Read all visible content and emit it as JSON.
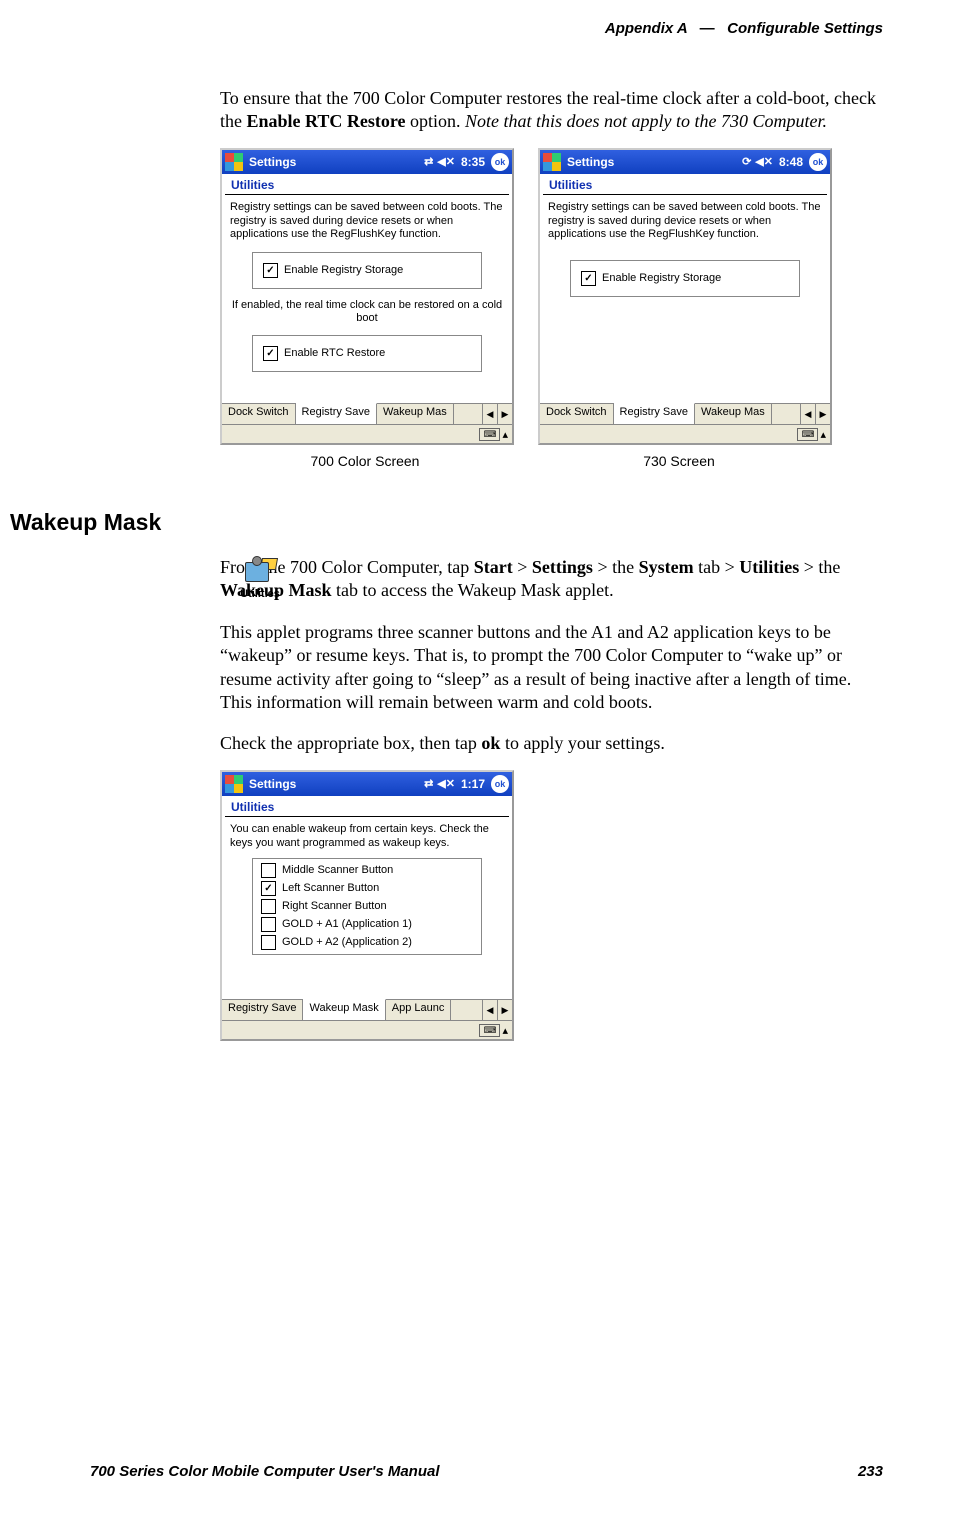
{
  "header": {
    "appendix": "Appendix A",
    "dash": "—",
    "title": "Configurable Settings"
  },
  "intro_para": {
    "pre": "To ensure that the 700 Color Computer restores the real-time clock after a cold-boot, check the ",
    "bold": "Enable RTC Restore",
    "mid": " option. ",
    "italic": "Note that this does not apply to the 730 Computer."
  },
  "screenshot_a": {
    "titlebar": {
      "title": "Settings",
      "time": "8:35",
      "ok": "ok"
    },
    "applet_title": "Utilities",
    "desc": "Registry settings can be saved between cold boots. The registry is saved during device resets or when applications use the RegFlushKey function.",
    "check1": {
      "label": "Enable Registry Storage",
      "checked": true
    },
    "note": "If enabled, the real time clock can be restored on a cold boot",
    "check2": {
      "label": "Enable RTC Restore",
      "checked": true
    },
    "tabs": [
      "Dock Switch",
      "Registry Save",
      "Wakeup Mas"
    ],
    "active_tab": 1,
    "caption": "700 Color Screen"
  },
  "screenshot_b": {
    "titlebar": {
      "title": "Settings",
      "time": "8:48",
      "ok": "ok"
    },
    "applet_title": "Utilities",
    "desc": "Registry settings can be saved between cold boots. The registry is saved during device resets or when applications use the RegFlushKey function.",
    "check1": {
      "label": "Enable Registry Storage",
      "checked": true
    },
    "tabs": [
      "Dock Switch",
      "Registry Save",
      "Wakeup Mas"
    ],
    "active_tab": 1,
    "caption": "730 Screen"
  },
  "section": {
    "heading": "Wakeup Mask",
    "icon_label": "Utilities",
    "para1": {
      "t1": "From the 700 Color Computer, tap ",
      "b1": "Start",
      "t2": " > ",
      "b2": "Settings",
      "t3": " > the ",
      "b3": "System",
      "t4": " tab > ",
      "b4": "Utilities",
      "t5": " > the ",
      "b5": "Wakeup Mask",
      "t6": " tab to access the Wakeup Mask applet."
    },
    "para2": "This applet programs three scanner buttons and the A1 and A2 application keys to be “wakeup” or resume keys. That is, to prompt the 700 Color Computer to “wake up” or resume activity after going to “sleep” as a result of being inactive after a length of time. This information will remain between warm and cold boots.",
    "para3": {
      "t1": "Check the appropriate box, then tap ",
      "b1": "ok",
      "t2": " to apply your settings."
    }
  },
  "screenshot_c": {
    "titlebar": {
      "title": "Settings",
      "time": "1:17",
      "ok": "ok"
    },
    "applet_title": "Utilities",
    "desc": "You can enable wakeup from certain keys. Check the keys you want programmed as wakeup keys.",
    "checks": [
      {
        "label": "Middle Scanner Button",
        "checked": false
      },
      {
        "label": "Left Scanner Button",
        "checked": true
      },
      {
        "label": "Right Scanner Button",
        "checked": false
      },
      {
        "label": "GOLD + A1 (Application 1)",
        "checked": false
      },
      {
        "label": "GOLD + A2 (Application 2)",
        "checked": false
      }
    ],
    "tabs": [
      "Registry Save",
      "Wakeup Mask",
      "App Launc"
    ],
    "active_tab": 1
  },
  "footer": {
    "left": "700 Series Color Mobile Computer User's Manual",
    "right": "233"
  }
}
